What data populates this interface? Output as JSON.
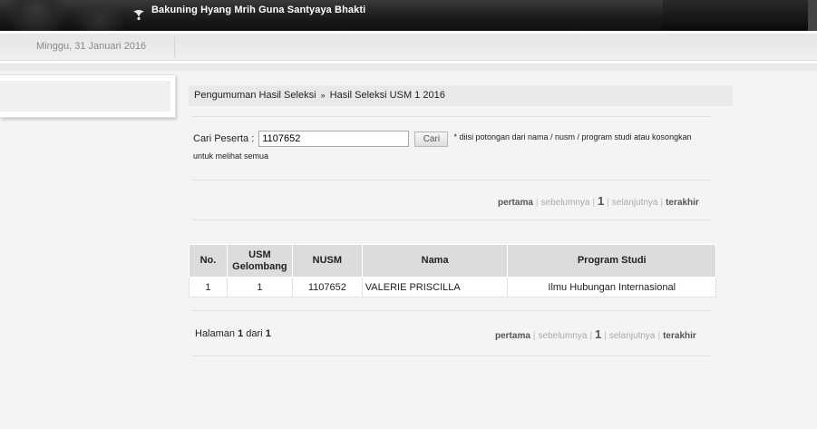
{
  "header": {
    "motto": "Bakuning Hyang Mrih Guna Santyaya Bhakti",
    "date": "Minggu, 31 Januari 2016"
  },
  "breadcrumb": {
    "items": [
      "Pengumuman Hasil Seleksi",
      "Hasil Seleksi USM 1 2016"
    ],
    "separator": "»"
  },
  "search": {
    "label": "Cari Peserta :",
    "value": "1107652",
    "button_label": "Cari",
    "note": "* diisi potongan dari nama / nusm / program studi atau kosongkan",
    "note_line2": "untuk melihat semua"
  },
  "pagination": {
    "first": "pertama",
    "prev": "sebelumnya",
    "current": "1",
    "next": "selanjutnya",
    "last": "terakhir",
    "separator": "|"
  },
  "table": {
    "headers": {
      "no": "No.",
      "usm_line1": "USM",
      "usm_line2": "Gelombang",
      "nusm": "NUSM",
      "nama": "Nama",
      "program": "Program Studi"
    },
    "rows": [
      {
        "no": "1",
        "gelombang": "1",
        "nusm": "1107652",
        "nama": "VALERIE PRISCILLA",
        "program": "Ilmu Hubungan Internasional"
      }
    ]
  },
  "page_info": {
    "prefix": "Halaman",
    "current": "1",
    "middle": "dari",
    "total": "1"
  }
}
